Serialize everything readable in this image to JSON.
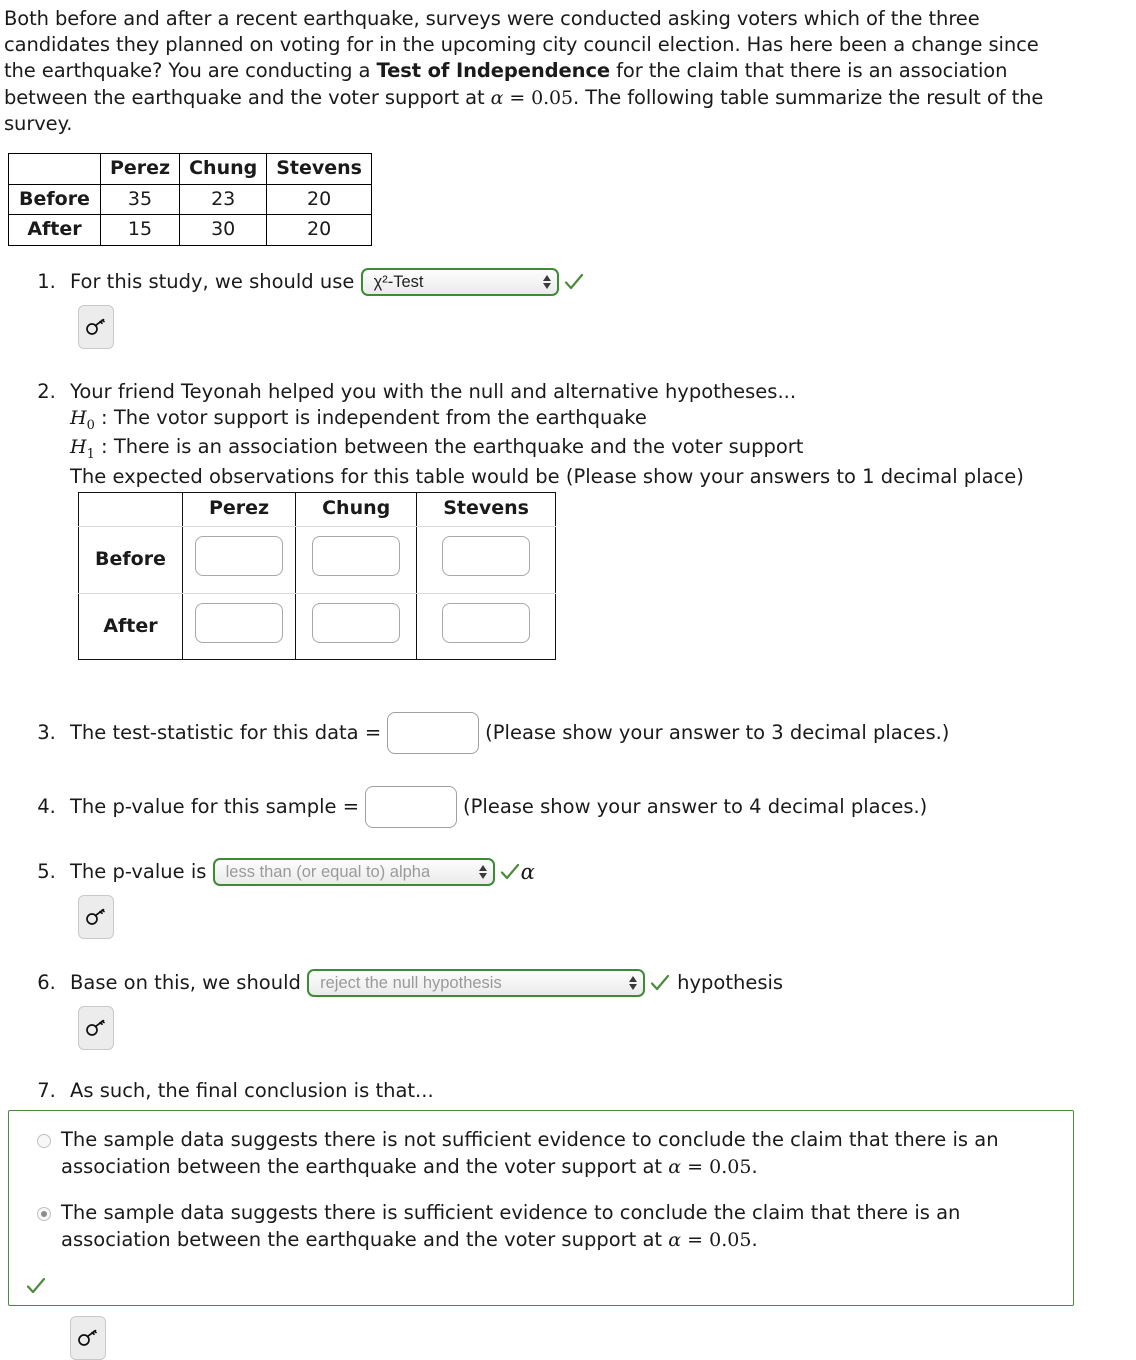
{
  "intro": {
    "part1": "Both before and after a recent earthquake, surveys were conducted asking voters which of the three candidates they planned on voting for in the upcoming city council election. Has here been a change since the earthquake? You are conducting a ",
    "bold": "Test of Independence",
    "part2": " for the claim that there is an association between the earthquake and the voter support at ",
    "alpha": "α",
    "equals": " = ",
    "alpha_value": "0.05",
    "part3": ". The following table summarize the result of the survey."
  },
  "observed_table": {
    "corner": "",
    "columns": [
      "Perez",
      "Chung",
      "Stevens"
    ],
    "rows": [
      {
        "label": "Before",
        "values": [
          "35",
          "23",
          "20"
        ]
      },
      {
        "label": "After",
        "values": [
          "15",
          "30",
          "20"
        ]
      }
    ]
  },
  "q1": {
    "text": "For this study, we should use",
    "select_value": "χ²-Test",
    "key_icon": "key-icon",
    "check_icon": "check-icon"
  },
  "q2": {
    "intro": "Your friend Teyonah helped you with the null and alternative hypotheses...",
    "h0_symbol": "H",
    "h0_sub": "0",
    "h0_text": " : The votor support is independent from the earthquake",
    "h1_symbol": "H",
    "h1_sub": "1",
    "h1_text": " : There is an association between the earthquake and the voter support",
    "expected_line": "The expected observations for this table would be (Please show your answers to 1 decimal place)",
    "table": {
      "corner": "",
      "columns": [
        "Perez",
        "Chung",
        "Stevens"
      ],
      "rows": [
        {
          "label": "Before",
          "values": [
            "",
            "",
            ""
          ]
        },
        {
          "label": "After",
          "values": [
            "",
            "",
            ""
          ]
        }
      ]
    }
  },
  "q3": {
    "text": "The test-statistic for this data =",
    "value": "",
    "hint": "(Please show your answer to 3 decimal places.)"
  },
  "q4": {
    "text": "The p-value for this sample =",
    "value": "",
    "hint": "(Please show your answer to 4 decimal places.)"
  },
  "q5": {
    "text": "The p-value is",
    "select_value": "less than (or equal to) alpha",
    "suffix_alpha": "α",
    "key_icon": "key-icon",
    "check_icon": "check-icon"
  },
  "q6": {
    "text": "Base on this, we should",
    "select_value": "reject the null hypothesis",
    "suffix": "hypothesis",
    "key_icon": "key-icon",
    "check_icon": "check-icon"
  },
  "q7": {
    "text": "As such, the final conclusion is that...",
    "options": [
      {
        "selected": false,
        "line1": "The sample data suggests there is not sufficient evidence to conclude the claim that there is an association between the earthquake and the voter support at ",
        "alpha": "α",
        "equals": " = ",
        "value": "0.05",
        "end": "."
      },
      {
        "selected": true,
        "line1": "The sample data suggests there is sufficient evidence to conclude the claim that there is an association between the earthquake and the voter support at ",
        "alpha": "α",
        "equals": " = ",
        "value": "0.05",
        "end": "."
      }
    ],
    "key_icon": "key-icon",
    "check_icon": "check-icon"
  },
  "colors": {
    "accent_green": "#3d8b34",
    "check_green": "#4b8b3b",
    "border_gray": "#a8a8a8",
    "placeholder_gray": "#9a9a9a"
  }
}
